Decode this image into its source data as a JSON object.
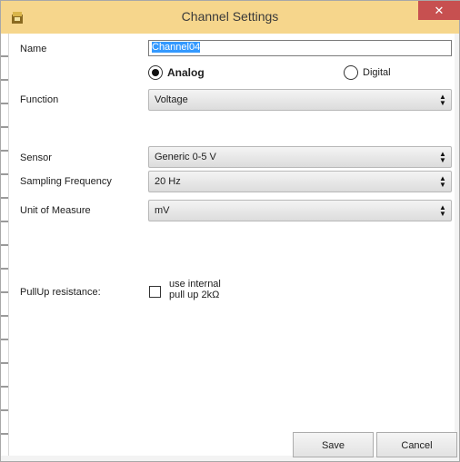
{
  "window": {
    "title": "Channel Settings",
    "close_glyph": "✕"
  },
  "fields": {
    "name": {
      "label": "Name",
      "value": "Channel04"
    },
    "mode": {
      "analog_label": "Analog",
      "digital_label": "Digital",
      "selected": "analog"
    },
    "function": {
      "label": "Function",
      "value": "Voltage"
    },
    "sensor": {
      "label": "Sensor",
      "value": "Generic 0-5 V"
    },
    "sampling": {
      "label": "Sampling Frequency",
      "value": "20 Hz"
    },
    "unit": {
      "label": "Unit of Measure",
      "value": "mV"
    },
    "pullup": {
      "label": "PullUp resistance:",
      "line1": "use internal",
      "line2": "pull up 2kΩ",
      "checked": false
    }
  },
  "buttons": {
    "save": "Save",
    "cancel": "Cancel"
  },
  "icons": {
    "app": "app-icon",
    "arrow": "updown-arrow-icon"
  },
  "colors": {
    "titlebar": "#f6d68c",
    "close": "#c75050",
    "selection": "#3399ff"
  }
}
